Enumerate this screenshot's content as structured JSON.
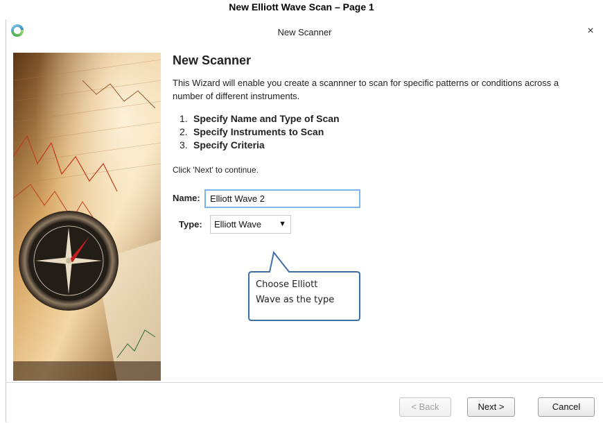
{
  "document": {
    "title": "New Elliott Wave Scan – Page 1"
  },
  "window": {
    "title": "New Scanner",
    "close_glyph": "×"
  },
  "wizard": {
    "heading": "New Scanner",
    "intro": "This Wizard will enable you create a scannner to scan for specific patterns or conditions across a number of different instruments.",
    "steps": [
      {
        "num": "1.",
        "text": "Specify Name and Type of Scan"
      },
      {
        "num": "2.",
        "text": "Specify Instruments to Scan"
      },
      {
        "num": "3.",
        "text": "Specify Criteria"
      }
    ],
    "continue_hint": "Click 'Next' to continue."
  },
  "form": {
    "name_label": "Name:",
    "name_value": "Elliott Wave 2",
    "type_label": "Type:",
    "type_value": "Elliott Wave",
    "type_arrow": "▼"
  },
  "callout": {
    "line1": "Choose Elliott",
    "line2": "Wave as the type"
  },
  "footer": {
    "back_label": "< Back",
    "next_label": "Next >",
    "cancel_label": "Cancel"
  },
  "colors": {
    "accent_input_border": "#7eb4ea",
    "callout_border": "#3d6fa3"
  },
  "icons": {
    "app": "app-logo-icon",
    "close": "close-icon",
    "side_image": "compass-finance-image"
  }
}
